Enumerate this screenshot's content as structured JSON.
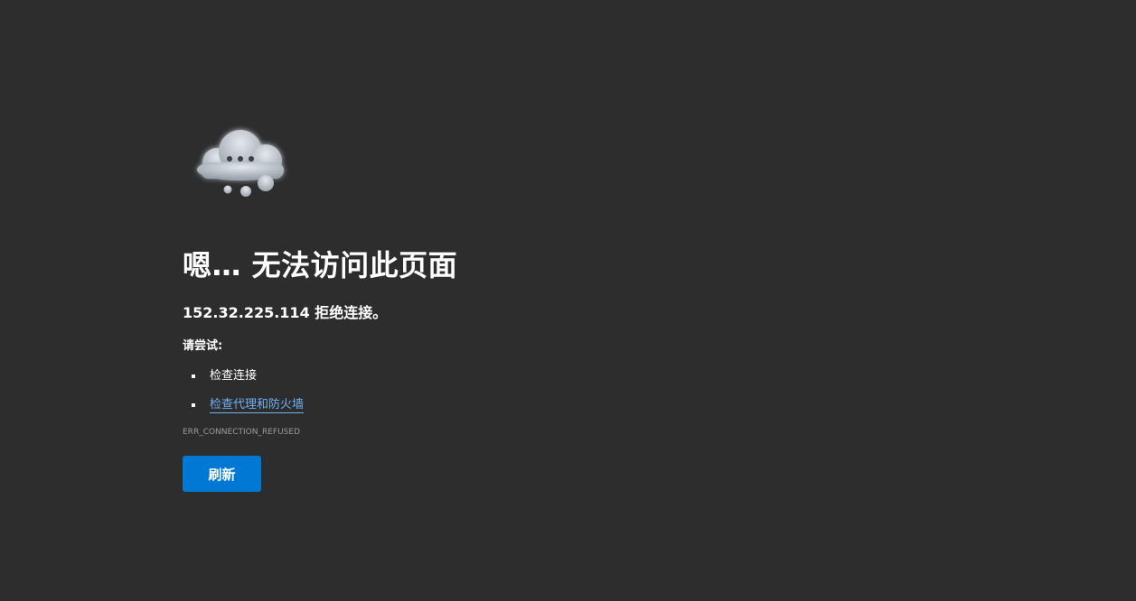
{
  "error": {
    "icon": "thinking-cloud-icon",
    "title": "嗯… 无法访问此页面",
    "message": "152.32.225.114 拒绝连接。",
    "try_label": "请尝试:",
    "suggestions": [
      {
        "label": "检查连接",
        "is_link": false
      },
      {
        "label": "检查代理和防火墙",
        "is_link": true
      }
    ],
    "code": "ERR_CONNECTION_REFUSED",
    "refresh_label": "刷新"
  },
  "colors": {
    "background": "#2d2d2d",
    "link": "#6fb0f0",
    "button": "#0078d4"
  }
}
